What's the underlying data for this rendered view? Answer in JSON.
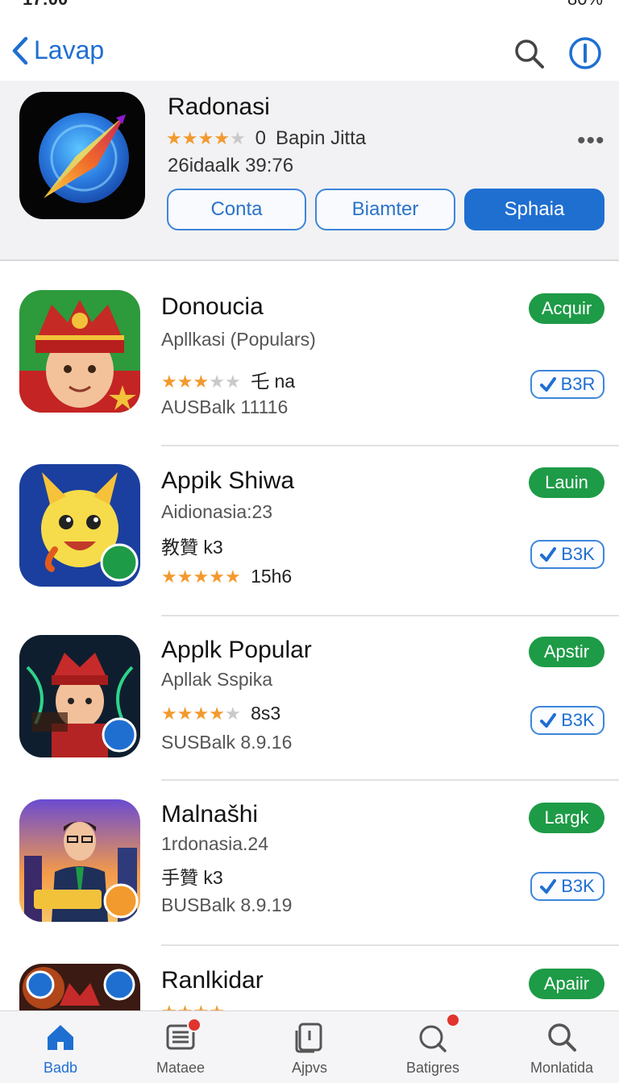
{
  "status": {
    "time": "17:00",
    "battery": "80%"
  },
  "nav": {
    "back_label": "Lavap"
  },
  "hero": {
    "title": "Radonasi",
    "rating_count": "0",
    "developer": "Bapin Jitta",
    "subtitle": "26idaalk 39:76",
    "buttons": [
      "Conta",
      "Biamter",
      "Sphaia"
    ],
    "stars": 4
  },
  "apps": [
    {
      "name": "Donoucia",
      "line1": "Apllkasi (Populars)",
      "line2_text": "乇 na",
      "line3": "AUSBalk 11116",
      "stars": 3.5,
      "action": "Acquir",
      "size": "B3R",
      "icon": "king-avatar-icon"
    },
    {
      "name": "Appik Shiwa",
      "line1": "Aidionasia:23",
      "line2_text": "教贊 k3",
      "line3_text": "15h6",
      "stars": 5,
      "action": "Lauin",
      "size": "B3K",
      "icon": "yellow-creature-icon"
    },
    {
      "name": "Applk Popular",
      "line1": "Apllak Sspika",
      "line2_text": "8s3",
      "line3": "SUSBalk 8.9.16",
      "stars": 4,
      "action": "Apstir",
      "size": "B3K",
      "icon": "warrior-king-icon"
    },
    {
      "name": "Malnašhi",
      "line1": "1rdonasia.24",
      "line2_text": "手贊 k3",
      "line3": "BUSBalk 8.9.19",
      "stars": 0,
      "action": "Largk",
      "size": "B3K",
      "icon": "businessman-city-icon"
    },
    {
      "name": "Ranlkidar",
      "action": "Apaiir",
      "stars": 4,
      "icon": "warrior-fire-icon"
    }
  ],
  "tabs": [
    {
      "label": "Badb",
      "icon": "home-icon"
    },
    {
      "label": "Mataee",
      "icon": "list-icon"
    },
    {
      "label": "Ajpvs",
      "icon": "apps-icon"
    },
    {
      "label": "Batigres",
      "icon": "games-icon"
    },
    {
      "label": "Monlatida",
      "icon": "search-icon"
    }
  ],
  "colors": {
    "accent": "#1f6fd1",
    "green": "#1e9b47",
    "star": "#f29a2e"
  }
}
